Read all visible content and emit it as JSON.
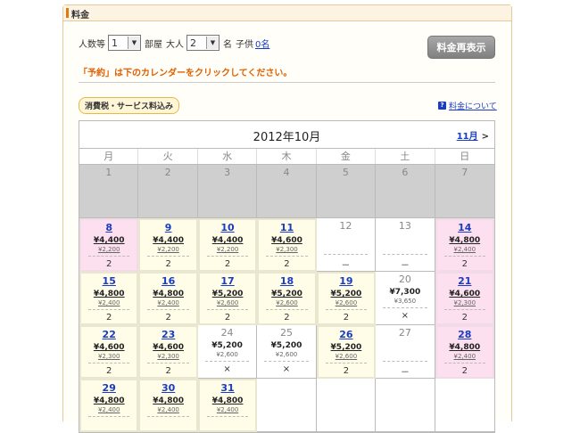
{
  "panel": {
    "title": "料金"
  },
  "form": {
    "group_label": "人数等",
    "rooms_value": "1",
    "rooms_suffix": "部屋",
    "adults_label": "大人",
    "adults_value": "2",
    "adults_suffix": "名",
    "children_label": "子供",
    "children_link": "0名",
    "recalc_button": "料金再表示"
  },
  "note": "「予約」は下のカレンダーをクリックしてください。",
  "tax_badge": "消費税・サービス料込み",
  "about_link": "料金について",
  "calendar": {
    "title": "2012年10月",
    "next_month": "11月",
    "next_arrow": ">",
    "weekdays": [
      "月",
      "火",
      "水",
      "木",
      "金",
      "土",
      "日"
    ],
    "days": [
      {
        "d": "1",
        "kind": "past"
      },
      {
        "d": "2",
        "kind": "past"
      },
      {
        "d": "3",
        "kind": "past"
      },
      {
        "d": "4",
        "kind": "past"
      },
      {
        "d": "5",
        "kind": "past"
      },
      {
        "d": "6",
        "kind": "past"
      },
      {
        "d": "7",
        "kind": "past"
      },
      {
        "d": "8",
        "kind": "holiday",
        "price": "¥4,400",
        "child": "¥2,200",
        "rooms": "2"
      },
      {
        "d": "9",
        "kind": "weekday",
        "price": "¥4,400",
        "child": "¥2,200",
        "rooms": "2"
      },
      {
        "d": "10",
        "kind": "weekday",
        "price": "¥4,400",
        "child": "¥2,200",
        "rooms": "2"
      },
      {
        "d": "11",
        "kind": "weekday",
        "price": "¥4,600",
        "child": "¥2,300",
        "rooms": "2"
      },
      {
        "d": "12",
        "kind": "none",
        "rooms": "－"
      },
      {
        "d": "13",
        "kind": "none",
        "rooms": "－"
      },
      {
        "d": "14",
        "kind": "holiday",
        "price": "¥4,800",
        "child": "¥2,400",
        "rooms": "2"
      },
      {
        "d": "15",
        "kind": "weekday",
        "price": "¥4,800",
        "child": "¥2,400",
        "rooms": "2"
      },
      {
        "d": "16",
        "kind": "weekday",
        "price": "¥4,800",
        "child": "¥2,400",
        "rooms": "2"
      },
      {
        "d": "17",
        "kind": "weekday",
        "price": "¥5,200",
        "child": "¥2,600",
        "rooms": "2"
      },
      {
        "d": "18",
        "kind": "weekday",
        "price": "¥5,200",
        "child": "¥2,600",
        "rooms": "2"
      },
      {
        "d": "19",
        "kind": "weekday",
        "price": "¥5,200",
        "child": "¥2,600",
        "rooms": "2"
      },
      {
        "d": "20",
        "kind": "full",
        "price": "¥7,300",
        "child": "¥3,650",
        "rooms": "×"
      },
      {
        "d": "21",
        "kind": "holiday",
        "price": "¥4,600",
        "child": "¥2,300",
        "rooms": "2"
      },
      {
        "d": "22",
        "kind": "weekday",
        "price": "¥4,600",
        "child": "¥2,300",
        "rooms": "2"
      },
      {
        "d": "23",
        "kind": "weekday",
        "price": "¥4,600",
        "child": "¥2,300",
        "rooms": "2"
      },
      {
        "d": "24",
        "kind": "full",
        "price": "¥5,200",
        "child": "¥2,600",
        "rooms": "×"
      },
      {
        "d": "25",
        "kind": "full",
        "price": "¥5,200",
        "child": "¥2,600",
        "rooms": "×"
      },
      {
        "d": "26",
        "kind": "weekday",
        "price": "¥5,200",
        "child": "¥2,600",
        "rooms": "2"
      },
      {
        "d": "27",
        "kind": "none",
        "rooms": "－"
      },
      {
        "d": "28",
        "kind": "holiday",
        "price": "¥4,800",
        "child": "¥2,400",
        "rooms": "2"
      },
      {
        "d": "29",
        "kind": "weekday",
        "price": "¥4,800",
        "child": "¥2,400",
        "rooms": ""
      },
      {
        "d": "30",
        "kind": "weekday",
        "price": "¥4,800",
        "child": "¥2,400",
        "rooms": ""
      },
      {
        "d": "31",
        "kind": "weekday",
        "price": "¥4,800",
        "child": "¥2,400",
        "rooms": ""
      },
      {
        "d": "",
        "kind": "empty"
      },
      {
        "d": "",
        "kind": "empty"
      },
      {
        "d": "",
        "kind": "empty"
      },
      {
        "d": "",
        "kind": "empty"
      }
    ]
  },
  "colors": {
    "accent": "#e07a10",
    "link": "#1a3bc4",
    "weekday_bg": "#fffde8",
    "holiday_bg": "#fde0f0",
    "past_bg": "#cfcfcf"
  }
}
